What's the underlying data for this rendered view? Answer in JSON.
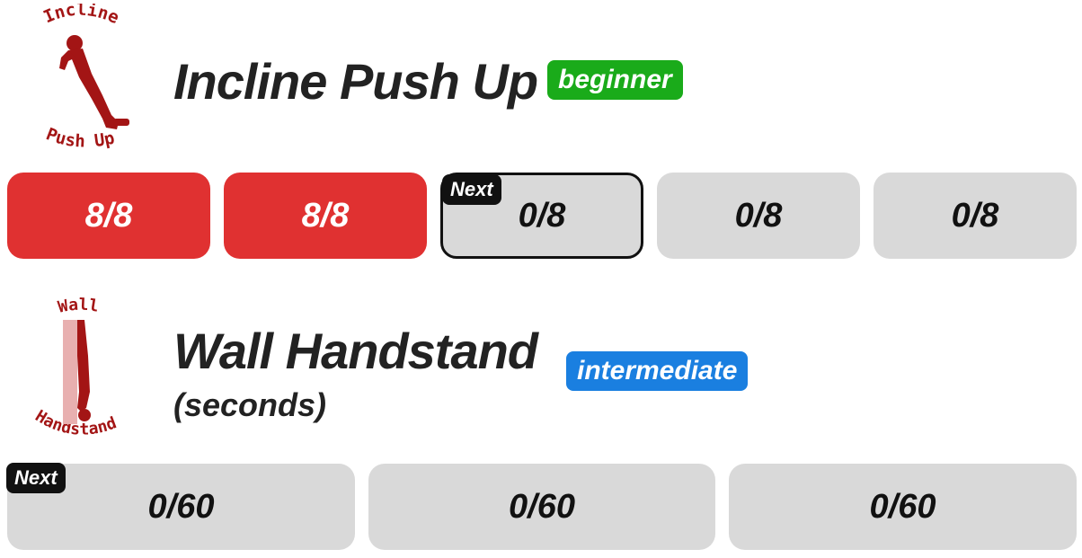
{
  "exercises": [
    {
      "logo_top": "Incline",
      "logo_bottom": "Push Up",
      "title": "Incline Push Up",
      "subtitle": "",
      "level": "beginner",
      "level_color": "#1aab1a",
      "sets": [
        {
          "label": "8/8",
          "reps_done": 8,
          "reps_target": 8,
          "state": "done"
        },
        {
          "label": "8/8",
          "reps_done": 8,
          "reps_target": 8,
          "state": "done"
        },
        {
          "label": "0/8",
          "reps_done": 0,
          "reps_target": 8,
          "state": "next",
          "tag": "Next"
        },
        {
          "label": "0/8",
          "reps_done": 0,
          "reps_target": 8,
          "state": "pending"
        },
        {
          "label": "0/8",
          "reps_done": 0,
          "reps_target": 8,
          "state": "pending"
        }
      ]
    },
    {
      "logo_top": "Wall",
      "logo_bottom": "Handstand",
      "title": "Wall Handstand",
      "subtitle": "(seconds)",
      "level": "intermediate",
      "level_color": "#1a7fe0",
      "sets": [
        {
          "label": "0/60",
          "reps_done": 0,
          "reps_target": 60,
          "state": "next",
          "tag": "Next"
        },
        {
          "label": "0/60",
          "reps_done": 0,
          "reps_target": 60,
          "state": "pending"
        },
        {
          "label": "0/60",
          "reps_done": 0,
          "reps_target": 60,
          "state": "pending"
        }
      ]
    }
  ],
  "colors": {
    "done": "#e03131",
    "pending": "#d9d9d9",
    "next_tag": "#111111",
    "logo": "#a31515"
  }
}
